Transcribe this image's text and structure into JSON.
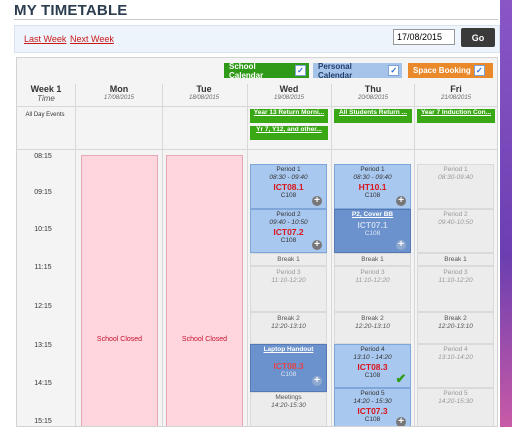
{
  "page_title": "MY TIMETABLE",
  "nav": {
    "last_week": "Last Week",
    "next_week": "Next Week",
    "date_value": "17/08/2015",
    "go_label": "Go"
  },
  "calendars": {
    "school": {
      "label": "School Calendar",
      "color": "#2f9a18"
    },
    "personal": {
      "label": "Personal Calendar",
      "color": "#a6c3ea"
    },
    "booking": {
      "label": "Space Booking",
      "color": "#e9892a"
    }
  },
  "header": {
    "week_label": "Week 1",
    "week_sub": "Time",
    "days": [
      {
        "name": "Mon",
        "date": "17/08/2015"
      },
      {
        "name": "Tue",
        "date": "18/08/2015"
      },
      {
        "name": "Wed",
        "date": "19/08/2015"
      },
      {
        "name": "Thu",
        "date": "20/08/2015"
      },
      {
        "name": "Fri",
        "date": "21/08/2015"
      }
    ]
  },
  "all_day": {
    "label": "All Day Events",
    "events": [
      {
        "day": "Wed",
        "text": "Year 13 Return Morni..."
      },
      {
        "day": "Wed",
        "text": "Yr 7, Y12, and other..."
      },
      {
        "day": "Thu",
        "text": "All Students Return ..."
      },
      {
        "day": "Fri",
        "text": "Year 7 Induction Con..."
      }
    ]
  },
  "times": [
    "08:15",
    "09:15",
    "10:15",
    "11:15",
    "12:15",
    "13:15",
    "14:15",
    "15:15"
  ],
  "school_closed": "School Closed",
  "wed": {
    "p1": {
      "name": "Period 1",
      "time": "08:30 - 09:40",
      "code": "ICT08.1",
      "room": "C108"
    },
    "p2": {
      "name": "Period 2",
      "time": "09:40 - 10:50",
      "code": "ICT07.2",
      "room": "C108"
    },
    "break1": "Break 1",
    "p3": {
      "name": "Period 3",
      "time": "11:10-12:20"
    },
    "break2": {
      "name": "Break 2",
      "time": "12:20-13:10"
    },
    "laptop": {
      "title": "Laptop Handout",
      "code": "ICT08.3",
      "room": "C108"
    },
    "meetings": {
      "name": "Meetings",
      "time": "14:20-15:30"
    }
  },
  "thu": {
    "p1": {
      "name": "Period 1",
      "time": "08:30 - 09:40",
      "code": "HT10.1",
      "room": "C108"
    },
    "p2": {
      "title": "P2, Cover BB",
      "code": "ICT07.1",
      "room": "C108"
    },
    "break1": "Break 1",
    "p3": {
      "name": "Period 3",
      "time": "11:10-12:20"
    },
    "break2": {
      "name": "Break 2",
      "time": "12:20-13:10"
    },
    "p4": {
      "name": "Period 4",
      "time": "13:10 - 14:20",
      "code": "ICT08.3",
      "room": "C108"
    },
    "p5": {
      "name": "Period 5",
      "time": "14:20 - 15:30",
      "code": "ICT07.3",
      "room": "C108"
    }
  },
  "fri": {
    "p1": {
      "name": "Period 1",
      "time": "08:30-09:40"
    },
    "p2": {
      "name": "Period 2",
      "time": "09:40-10:50"
    },
    "break1": "Break 1",
    "p3": {
      "name": "Period 3",
      "time": "11:10-12:20"
    },
    "break2": {
      "name": "Break 2",
      "time": "12:20-13:10"
    },
    "p4": {
      "name": "Period 4",
      "time": "13:10-14:20"
    },
    "p5": {
      "name": "Period 5",
      "time": "14:20-15:30"
    }
  }
}
